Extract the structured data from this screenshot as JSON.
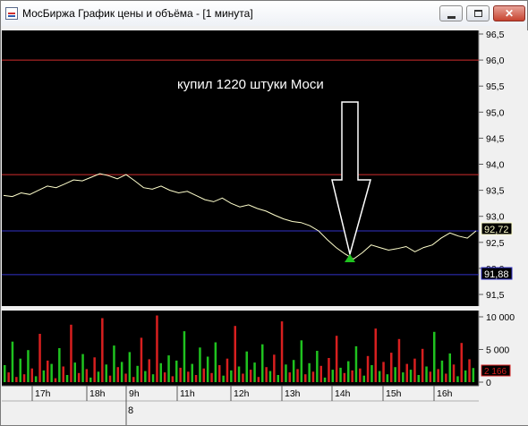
{
  "window": {
    "title": "МосБиржа График цены и объёма - [1 минута]",
    "buttons": {
      "minimize": "minimize",
      "maximize": "maximize",
      "close": "✕"
    }
  },
  "price_axis": {
    "ticks": [
      "96,5",
      "96,0",
      "95,5",
      "95,0",
      "94,5",
      "94,0",
      "93,5",
      "93,0",
      "92,5",
      "92,0",
      "91,5"
    ],
    "current_price": "92,72",
    "lower_level": "91,88"
  },
  "volume_axis": {
    "ticks": [
      "10 000",
      "5 000",
      "0"
    ],
    "current_volume": "2 166"
  },
  "time_axis": {
    "labels": [
      "17h",
      "18h",
      "9h",
      "11h",
      "12h",
      "13h",
      "14h",
      "15h",
      "16h"
    ],
    "day_label": "8"
  },
  "annotation": {
    "text": "купил 1220 штуки Моси"
  },
  "colors": {
    "background": "#000000",
    "price_line": "#ffffcc",
    "level_red": "#d22c2c",
    "level_blue": "#3232c8",
    "volume_up": "#1fc21f",
    "volume_down": "#d81f1f",
    "axis_text": "#ffffff"
  },
  "chart_data": [
    {
      "type": "line",
      "title": "",
      "xlabel": "",
      "ylabel": "",
      "ylim": [
        91.3,
        96.6
      ],
      "series": [
        {
          "values": [
            93.4,
            93.38,
            93.45,
            93.42,
            93.5,
            93.58,
            93.55,
            93.62,
            93.7,
            93.68,
            93.75,
            93.82,
            93.78,
            93.72,
            93.8,
            93.68,
            93.55,
            93.52,
            93.58,
            93.5,
            93.45,
            93.48,
            93.4,
            93.32,
            93.28,
            93.35,
            93.25,
            93.18,
            93.22,
            93.15,
            93.1,
            93.02,
            92.95,
            92.9,
            92.88,
            92.82,
            92.72,
            92.55,
            92.4,
            92.28,
            92.18,
            92.3,
            92.45,
            92.4,
            92.35,
            92.38,
            92.42,
            92.32,
            92.4,
            92.45,
            92.58,
            92.68,
            92.62,
            92.58,
            92.72
          ]
        }
      ],
      "horizontal_levels": [
        96.0,
        93.8,
        92.72,
        91.88
      ]
    },
    {
      "type": "bar",
      "title": "",
      "ylim": [
        0,
        11000
      ],
      "volumes": [
        2600,
        1500,
        6200,
        800,
        3600,
        1200,
        4900,
        2100,
        900,
        7400,
        1800,
        3300,
        2800,
        600,
        5200,
        2400,
        1100,
        8800,
        3000,
        1400,
        4300,
        2000,
        700,
        3800,
        1600,
        9800,
        2700,
        1000,
        5600,
        2300,
        3100,
        1300,
        4600,
        800,
        2500,
        6800,
        1700,
        3500,
        1200,
        10200,
        2900,
        1500,
        4100,
        900,
        3300,
        2200,
        7800,
        1600,
        2800,
        1100,
        5300,
        2100,
        3900,
        1400,
        6100,
        2600,
        1000,
        3600,
        1800,
        8600,
        2400,
        1300,
        4700,
        1900,
        3000,
        800,
        5800,
        2300,
        1700,
        4200,
        1100,
        9300,
        2700,
        1500,
        3400,
        2000,
        6400,
        1200,
        2900,
        1600,
        4800,
        2500,
        700,
        3700,
        1900,
        7100,
        2200,
        1400,
        3200,
        1800,
        5500,
        2100,
        1000,
        4000,
        2600,
        8200,
        1700,
        3100,
        1200,
        4500,
        2300,
        6600,
        1500,
        2800,
        1900,
        3600,
        1100,
        5100,
        2400,
        1600,
        7700,
        2000,
        3300,
        1300,
        4400,
        2700,
        900,
        6000,
        1800,
        3500,
        2166
      ],
      "volume_colors": [
        "up",
        "down",
        "up",
        "down",
        "up",
        "down",
        "up",
        "down",
        "up",
        "down",
        "up",
        "down",
        "up",
        "down",
        "up",
        "down",
        "up",
        "down",
        "up",
        "down",
        "up",
        "down",
        "up",
        "down",
        "up",
        "down",
        "up",
        "down",
        "up",
        "down",
        "up",
        "down",
        "up",
        "down",
        "up",
        "down",
        "up",
        "down",
        "up",
        "down",
        "up",
        "down",
        "up",
        "down",
        "up",
        "down",
        "up",
        "down",
        "up",
        "down",
        "up",
        "down",
        "up",
        "down",
        "up",
        "down",
        "up",
        "down",
        "up",
        "down",
        "up",
        "down",
        "up",
        "down",
        "up",
        "down",
        "up",
        "down",
        "up",
        "down",
        "up",
        "down",
        "up",
        "down",
        "up",
        "down",
        "up",
        "down",
        "up",
        "down",
        "up",
        "down",
        "up",
        "down",
        "up",
        "down",
        "up",
        "down",
        "up",
        "down",
        "up",
        "down",
        "up",
        "down",
        "up",
        "down",
        "up",
        "down",
        "up",
        "down",
        "up",
        "down",
        "up",
        "down",
        "up",
        "down",
        "up",
        "down",
        "up",
        "down",
        "up",
        "down",
        "up",
        "down",
        "up",
        "down",
        "up",
        "down",
        "up",
        "down",
        "up"
      ]
    }
  ]
}
